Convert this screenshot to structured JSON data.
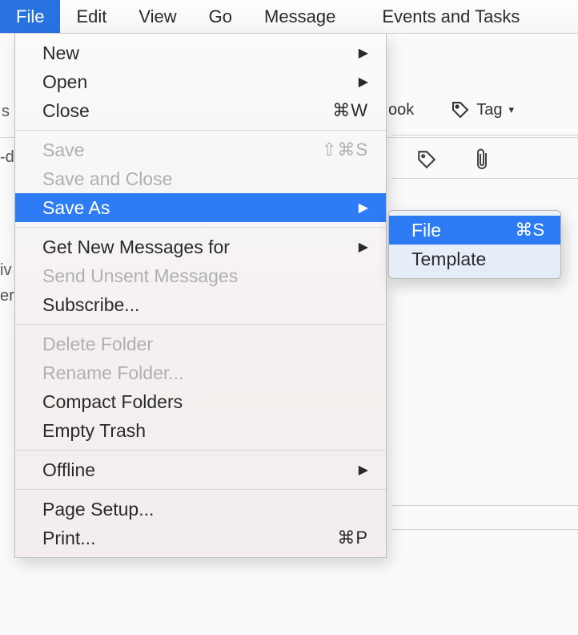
{
  "menubar": {
    "items": [
      {
        "label": "File",
        "active": true
      },
      {
        "label": "Edit"
      },
      {
        "label": "View"
      },
      {
        "label": "Go"
      },
      {
        "label": "Message"
      },
      {
        "label": "Events and Tasks"
      }
    ]
  },
  "toolbar": {
    "book_fragment": "ook",
    "tag_label": "Tag"
  },
  "bg": {
    "s": "s",
    "dash": "-d",
    "iv": "iv",
    "er": "er"
  },
  "file_menu": {
    "groups": [
      [
        {
          "label": "New",
          "submenu": true
        },
        {
          "label": "Open",
          "submenu": true
        },
        {
          "label": "Close",
          "shortcut": "⌘W"
        }
      ],
      [
        {
          "label": "Save",
          "shortcut": "⇧⌘S",
          "disabled": true
        },
        {
          "label": "Save and Close",
          "disabled": true
        },
        {
          "label": "Save As",
          "submenu": true,
          "highlight": true
        }
      ],
      [
        {
          "label": "Get New Messages for",
          "submenu": true
        },
        {
          "label": "Send Unsent Messages",
          "disabled": true
        },
        {
          "label": "Subscribe..."
        }
      ],
      [
        {
          "label": "Delete Folder",
          "disabled": true
        },
        {
          "label": "Rename Folder...",
          "disabled": true
        },
        {
          "label": "Compact Folders"
        },
        {
          "label": "Empty Trash"
        }
      ],
      [
        {
          "label": "Offline",
          "submenu": true
        }
      ],
      [
        {
          "label": "Page Setup..."
        },
        {
          "label": "Print...",
          "shortcut": "⌘P"
        }
      ]
    ]
  },
  "save_as_submenu": {
    "items": [
      {
        "label": "File",
        "shortcut": "⌘S",
        "highlight": true
      },
      {
        "label": "Template"
      }
    ]
  }
}
